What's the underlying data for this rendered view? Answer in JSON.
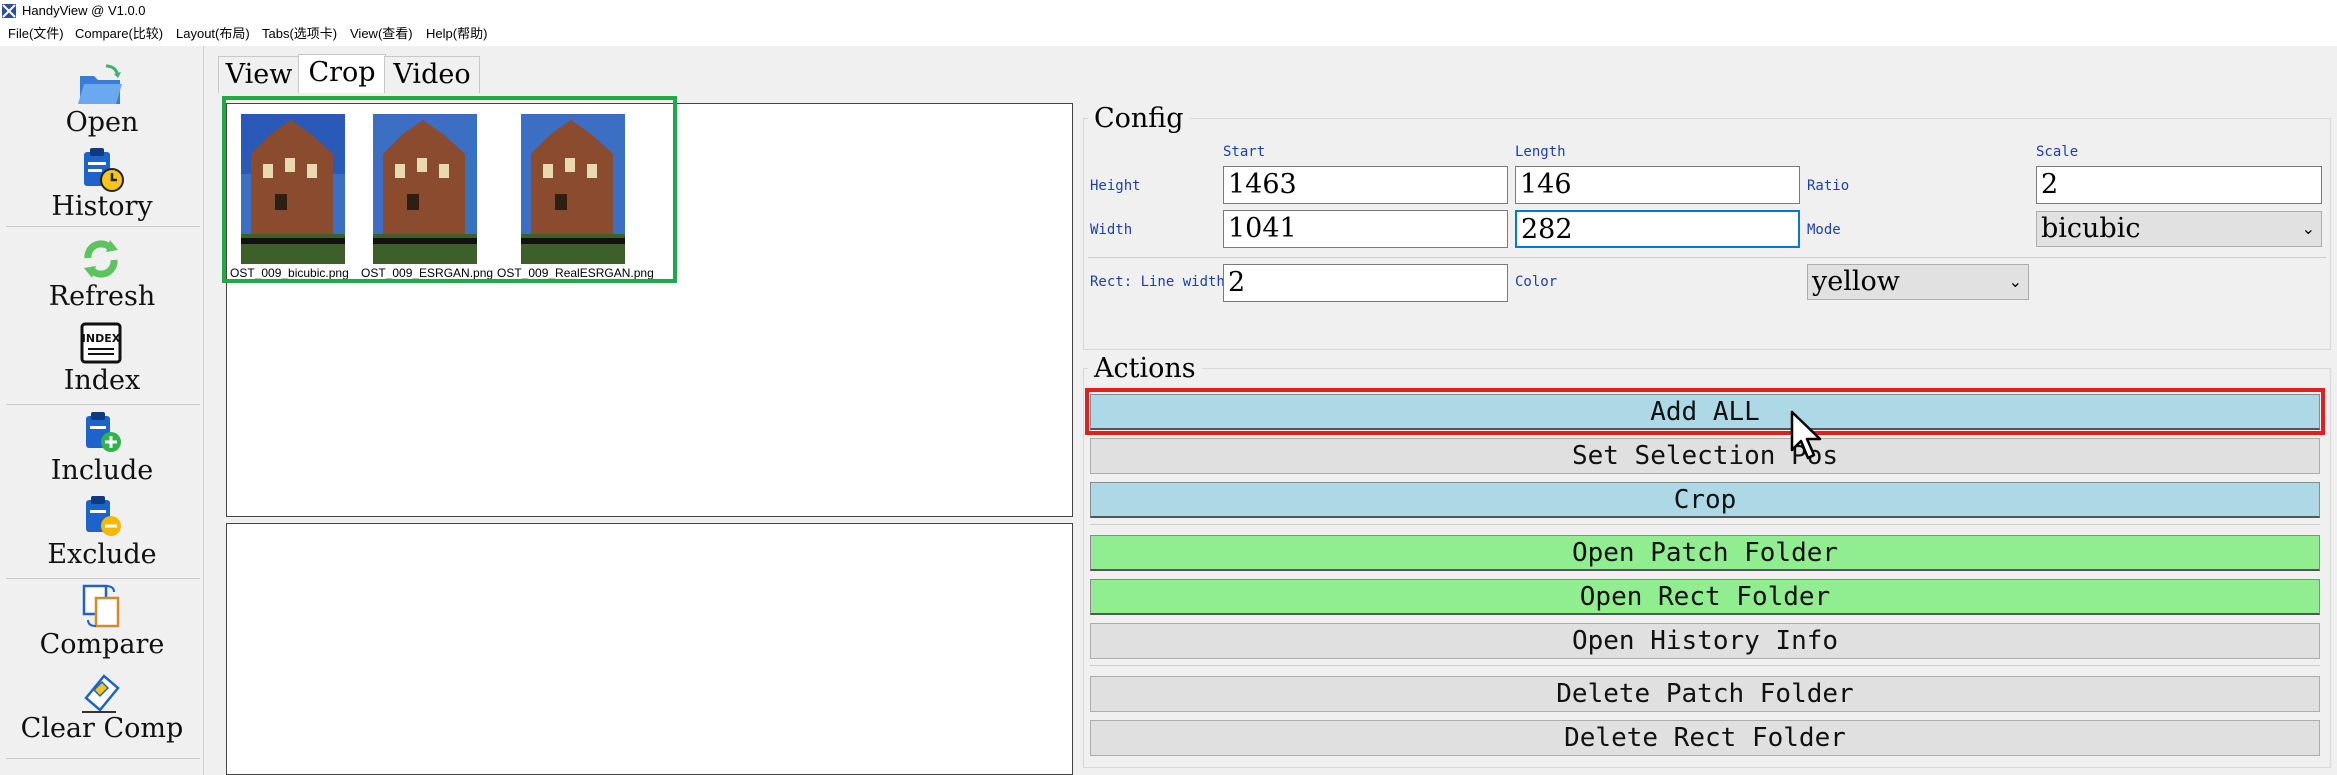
{
  "app": {
    "title": "HandyView @ V1.0.0"
  },
  "menu": [
    "File(文件)",
    "Compare(比较)",
    "Layout(布局)",
    "Tabs(选项卡)",
    "View(查看)",
    "Help(帮助)"
  ],
  "toolbar": {
    "open": "Open",
    "history": "History",
    "refresh": "Refresh",
    "index": "Index",
    "index_icon_text": "INDEX",
    "include": "Include",
    "exclude": "Exclude",
    "compare": "Compare",
    "clear_comp": "Clear Comp"
  },
  "tabs": [
    {
      "label": "View",
      "active": false
    },
    {
      "label": "Crop",
      "active": true
    },
    {
      "label": "Video",
      "active": false
    }
  ],
  "thumbnails": [
    "OST_009_bicubic.png",
    "OST_009_ESRGAN.png",
    "OST_009_RealESRGAN.png"
  ],
  "config": {
    "title": "Config",
    "start_header": "Start",
    "length_header": "Length",
    "scale_header": "Scale",
    "height_label": "Height",
    "height_start": "1463",
    "height_length": "146",
    "ratio_label": "Ratio",
    "scale_value": "2",
    "width_label": "Width",
    "width_start": "1041",
    "width_length": "282",
    "mode_label": "Mode",
    "mode_value": "bicubic",
    "rect_line_label": "Rect: Line width",
    "rect_line_value": "2",
    "color_label": "Color",
    "color_value": "yellow"
  },
  "actions": {
    "title": "Actions",
    "add_all": "Add ALL",
    "set_selection_pos": "Set Selection Pos",
    "crop": "Crop",
    "open_patch_folder": "Open Patch Folder",
    "open_rect_folder": "Open Rect Folder",
    "open_history_info": "Open History Info",
    "delete_patch_folder": "Delete Patch Folder",
    "delete_rect_folder": "Delete Rect Folder"
  },
  "colors": {
    "highlight_green": "#22a845",
    "highlight_red": "#e0201e",
    "button_blue": "#add8e6",
    "button_green": "#90ee90",
    "button_gray": "#e0e0e0",
    "label_blue": "#1a3fb0"
  }
}
